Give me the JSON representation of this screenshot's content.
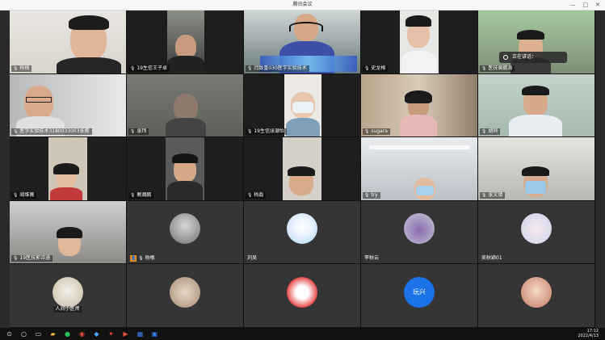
{
  "window": {
    "title": "腾讯会议",
    "min": "—",
    "max": "□",
    "close": "✕"
  },
  "notice": {
    "text": "正在讲话："
  },
  "participants": [
    {
      "name": "杨根"
    },
    {
      "name": "19生信王子卓"
    },
    {
      "name": "闫致重030医学实验技术"
    },
    {
      "name": "史龙格"
    },
    {
      "name": "医技黄鹏涛"
    },
    {
      "name": "医学实验技术3180033003张腾"
    },
    {
      "name": "张玮"
    },
    {
      "name": "19生信张潮怡"
    },
    {
      "name": "sugara"
    },
    {
      "name": "胡同"
    },
    {
      "name": "阎维薇"
    },
    {
      "name": "赖瀚鹏"
    },
    {
      "name": "杨磊"
    },
    {
      "name": "try"
    },
    {
      "name": "张文镇"
    },
    {
      "name": "19医技郭诗涵"
    },
    {
      "name": "杨根"
    },
    {
      "name": "刘昊"
    },
    {
      "name": "李秋云"
    },
    {
      "name": "吴秋颖01"
    },
    {
      "name": "人间小医师"
    },
    {
      "name": ""
    },
    {
      "name": ""
    },
    {
      "name": "玩兴"
    },
    {
      "name": ""
    }
  ],
  "taskbar": {
    "time": "17:12",
    "date": "2022/4/13"
  },
  "colors": {
    "accent": "#1a73e8",
    "background": "#2a2a2a"
  }
}
